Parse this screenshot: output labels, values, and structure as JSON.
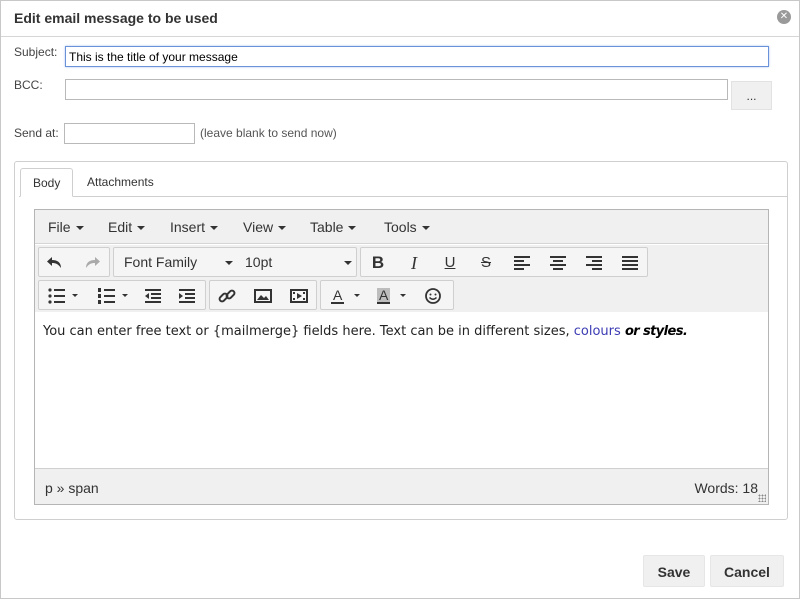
{
  "dialog": {
    "title": "Edit email message to be used",
    "close_icon": "close-icon"
  },
  "form": {
    "subject_label": "Subject:",
    "subject_value": "This is the title of your message",
    "bcc_label": "BCC:",
    "bcc_value": "",
    "bcc_button_label": "...",
    "send_at_label": "Send at:",
    "send_at_value": "",
    "send_at_hint": "(leave blank to send now)"
  },
  "tabs": [
    {
      "label": "Body",
      "active": true
    },
    {
      "label": "Attachments",
      "active": false
    }
  ],
  "editor": {
    "menu": [
      "File",
      "Edit",
      "Insert",
      "View",
      "Table",
      "Tools"
    ],
    "font_family": "Font Family",
    "font_size": "10pt",
    "icons": {
      "row1": [
        "undo-icon",
        "redo-icon",
        "bold-icon",
        "italic-icon",
        "underline-icon",
        "strikethrough-icon",
        "align-left-icon",
        "align-center-icon",
        "align-right-icon",
        "justify-icon"
      ],
      "row2": [
        "bullet-list-icon",
        "numbered-list-icon",
        "outdent-icon",
        "indent-icon",
        "link-icon",
        "image-icon",
        "media-icon",
        "text-color-icon",
        "background-color-icon",
        "emoticons-icon"
      ]
    },
    "content": {
      "text_plain": "You can enter free text or {mailmerge} fields here. Text can be in different sizes, ",
      "text_colours": "colours",
      "text_styles": "or styles.",
      "colours_color": "#3b3bb4"
    },
    "status_path": "p » span",
    "word_count": "Words: 18"
  },
  "footer": {
    "save_label": "Save",
    "cancel_label": "Cancel"
  }
}
